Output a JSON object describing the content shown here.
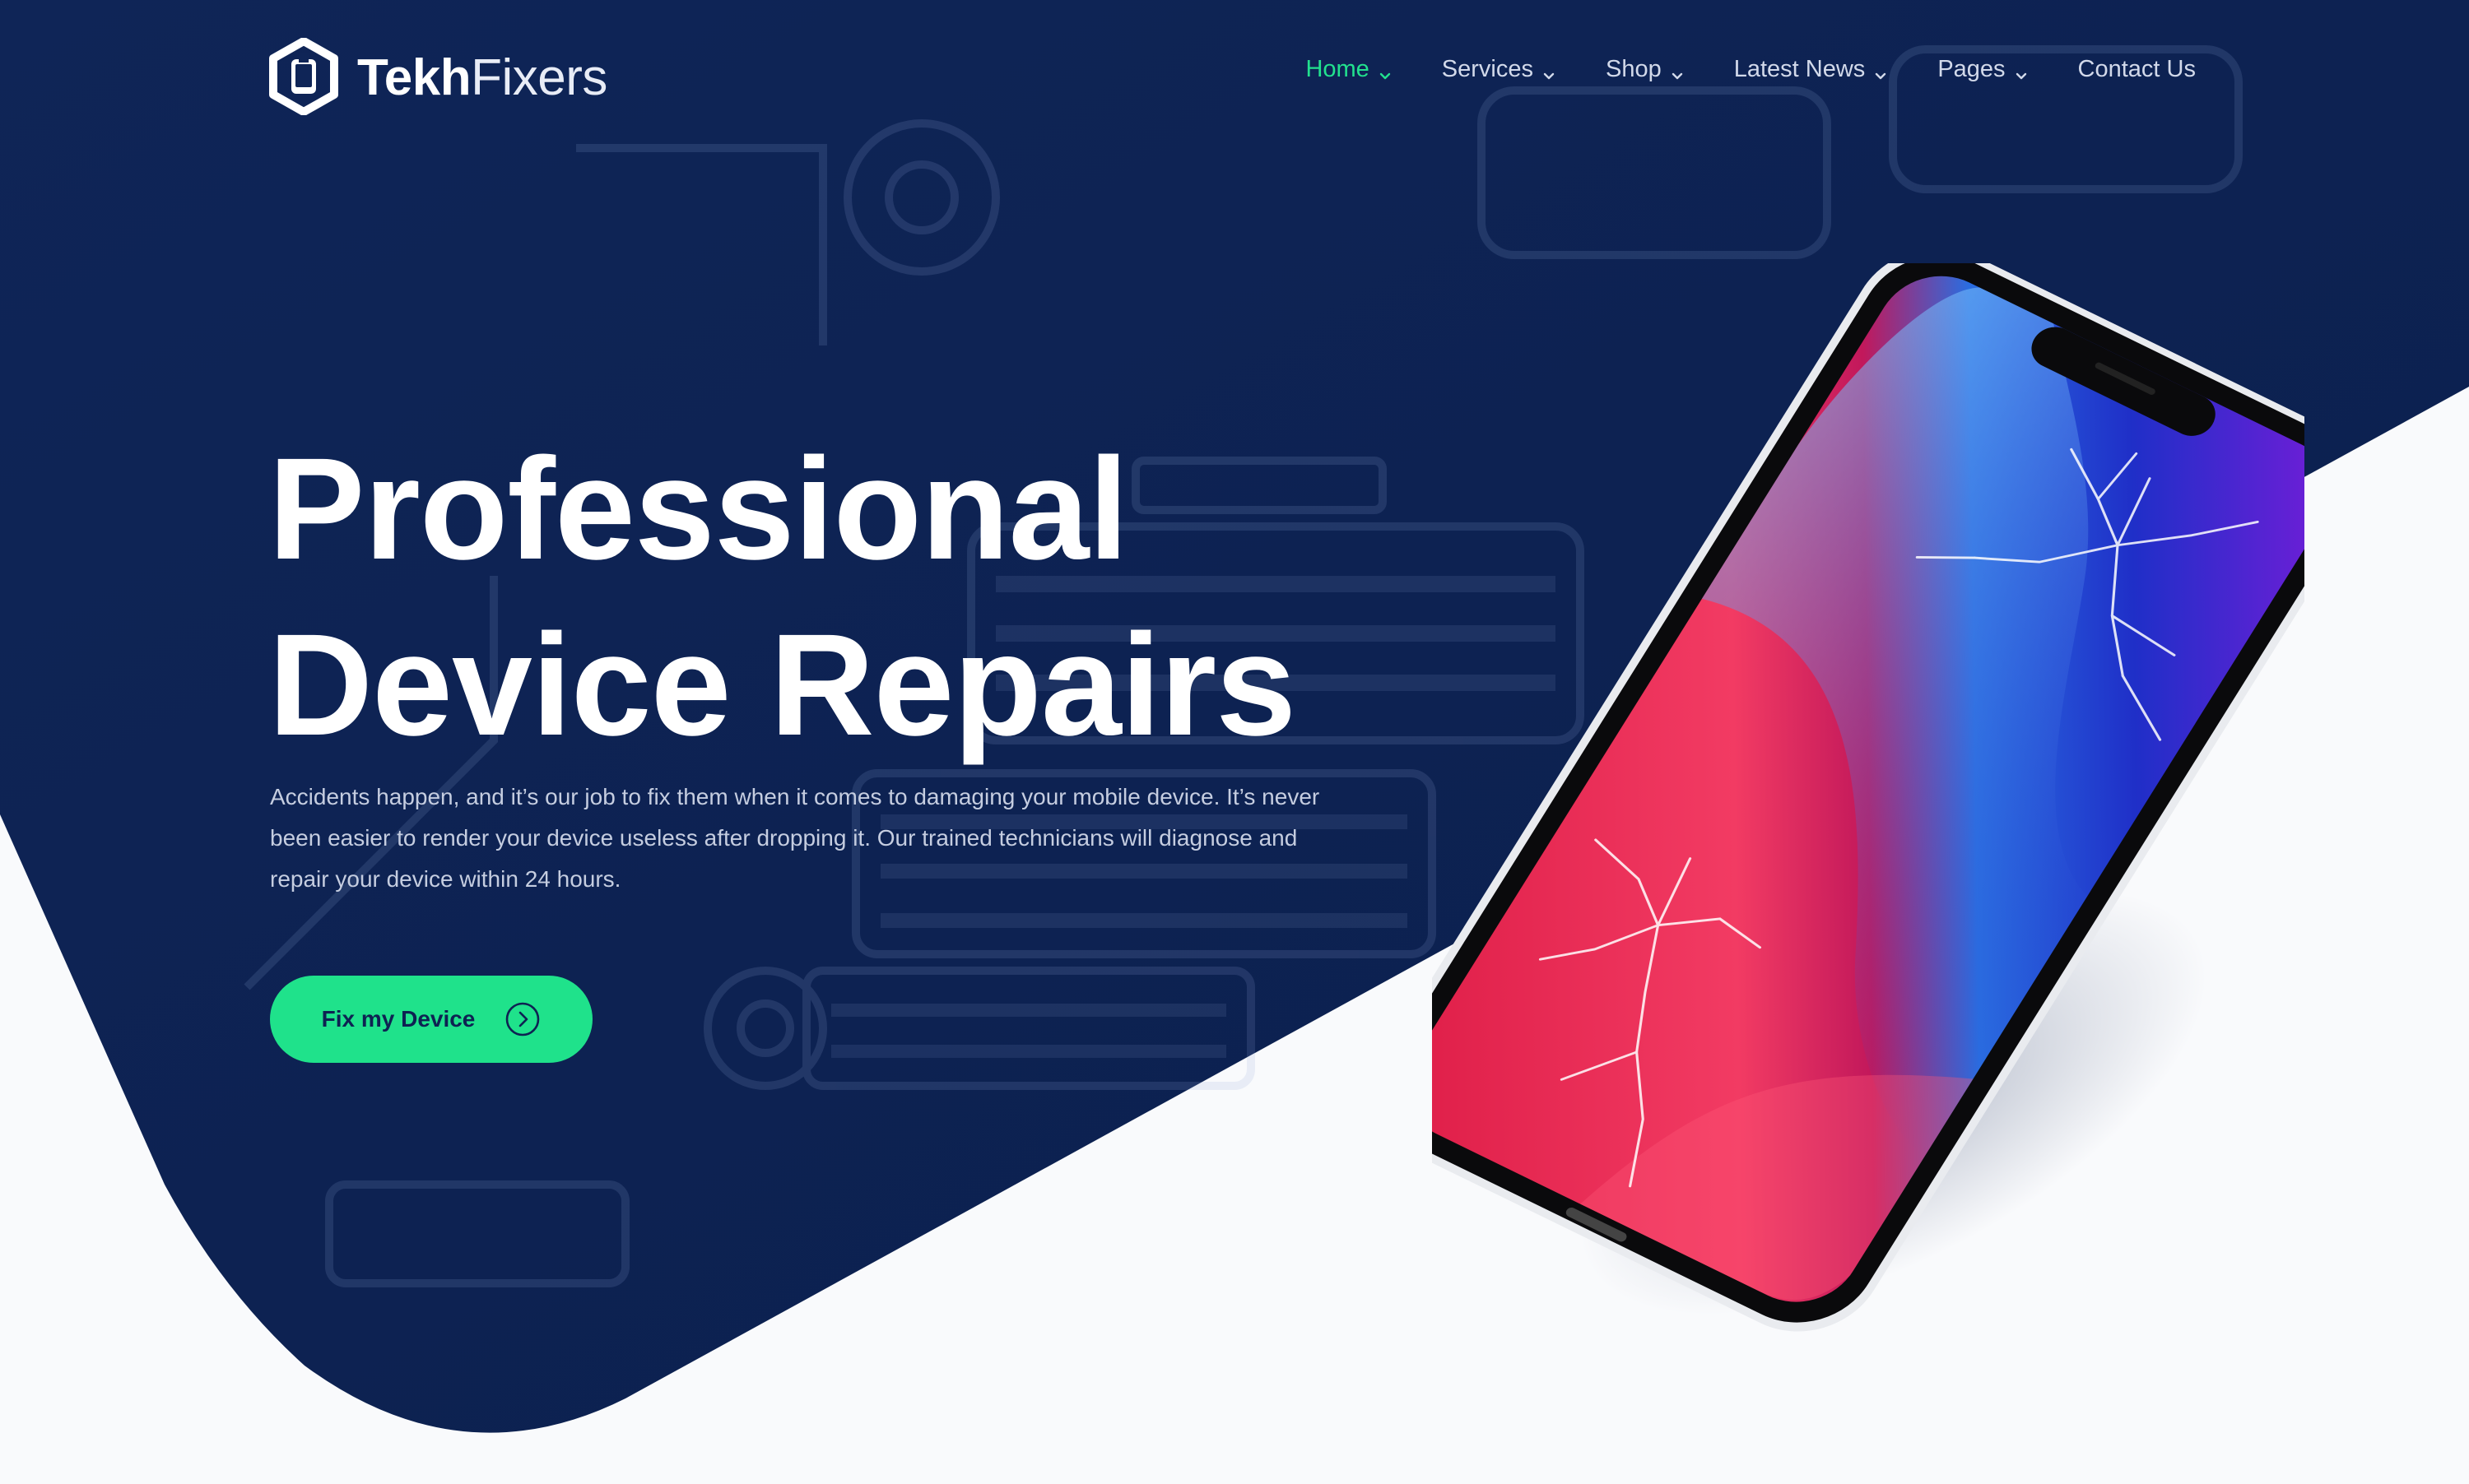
{
  "brand": {
    "name_bold": "Tekh",
    "name_light": "Fixers",
    "logo_icon": "wrench-phone-icon"
  },
  "colors": {
    "navy": "#0e2252",
    "accent_green": "#1fe28b",
    "nav_text": "#d2d9ea",
    "page_bg": "#f9fafc"
  },
  "nav": {
    "items": [
      {
        "label": "Home",
        "has_dropdown": true,
        "active": true
      },
      {
        "label": "Services",
        "has_dropdown": true,
        "active": false
      },
      {
        "label": "Shop",
        "has_dropdown": true,
        "active": false
      },
      {
        "label": "Latest News",
        "has_dropdown": true,
        "active": false
      },
      {
        "label": "Pages",
        "has_dropdown": true,
        "active": false
      },
      {
        "label": "Contact Us",
        "has_dropdown": false,
        "active": false
      }
    ]
  },
  "hero": {
    "title_line1": "Professional",
    "title_line2": "Device Repairs",
    "description": "Accidents happen, and it’s our job to fix them when it comes to damaging your mobile device. It’s never been easier to render your device useless after dropping it. Our trained technicians will diagnose and repair your device within 24 hours.",
    "cta_label": "Fix my Device",
    "cta_icon": "chevron-right-circle-icon"
  },
  "visual": {
    "phone_image": "cracked-smartphone-illustration"
  }
}
